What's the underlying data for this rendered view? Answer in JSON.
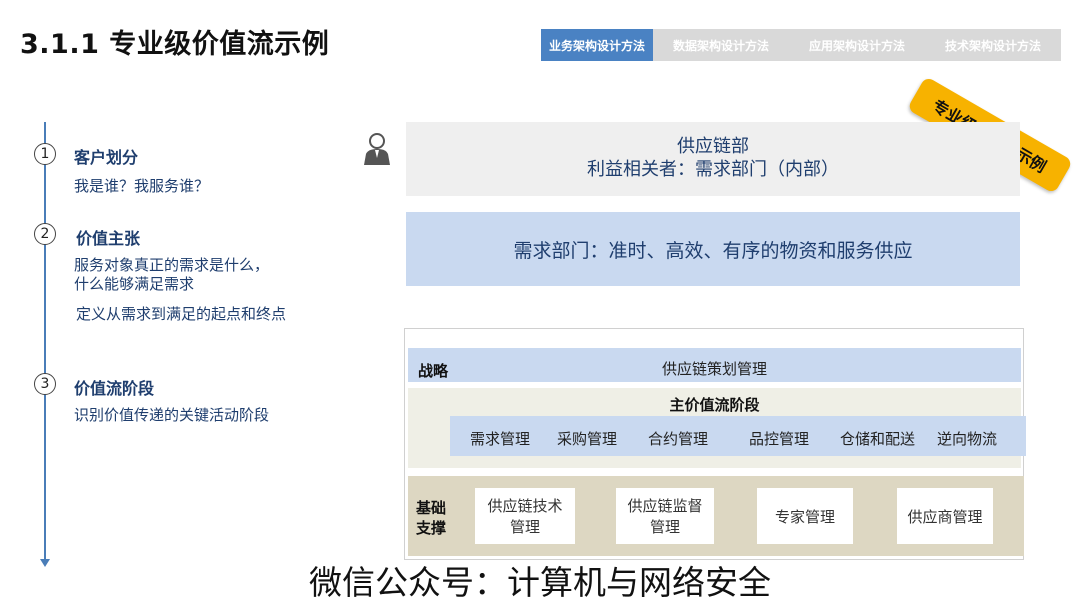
{
  "title": "3.1.1 专业级价值流示例",
  "tabs": [
    {
      "label": "业务架构设计方法",
      "active": true
    },
    {
      "label": "数据架构设计方法",
      "active": false
    },
    {
      "label": "应用架构设计方法",
      "active": false
    },
    {
      "label": "技术架构设计方法",
      "active": false
    }
  ],
  "badge": "专业级价值流示例",
  "steps": [
    {
      "num": "1",
      "title": "客户划分",
      "desc": [
        "我是谁？我服务谁？"
      ]
    },
    {
      "num": "2",
      "title": "价值主张",
      "desc": [
        "服务对象真正的需求是什么，",
        "什么能够满足需求",
        "定义从需求到满足的起点和终点"
      ]
    },
    {
      "num": "3",
      "title": "价值流阶段",
      "desc": [
        "识别价值传递的关键活动阶段"
      ]
    }
  ],
  "supply": {
    "line1": "供应链部",
    "line2": "利益相关者：需求部门（内部）"
  },
  "demand": "需求部门：准时、高效、有序的物资和服务供应",
  "strategy": {
    "label": "战略",
    "text": "供应链策划管理"
  },
  "main_stage": {
    "title": "主价值流阶段",
    "activities": [
      "需求管理",
      "采购管理",
      "合约管理",
      "品控管理",
      "仓储和配送",
      "逆向物流"
    ]
  },
  "support": {
    "label_line1": "基础",
    "label_line2": "支撑",
    "boxes": [
      {
        "line1": "供应链技术",
        "line2": "管理"
      },
      {
        "line1": "供应链监督",
        "line2": "管理"
      },
      {
        "line1": "专家管理",
        "line2": ""
      },
      {
        "line1": "供应商管理",
        "line2": ""
      }
    ]
  },
  "watermark": "微信公众号：计算机与网络安全",
  "colors": {
    "accent": "#4a82c3",
    "badge": "#f7b200",
    "light_blue": "#c9d9f0",
    "text_blue": "#1f3e6e"
  },
  "icons": {
    "person": "person-icon"
  }
}
